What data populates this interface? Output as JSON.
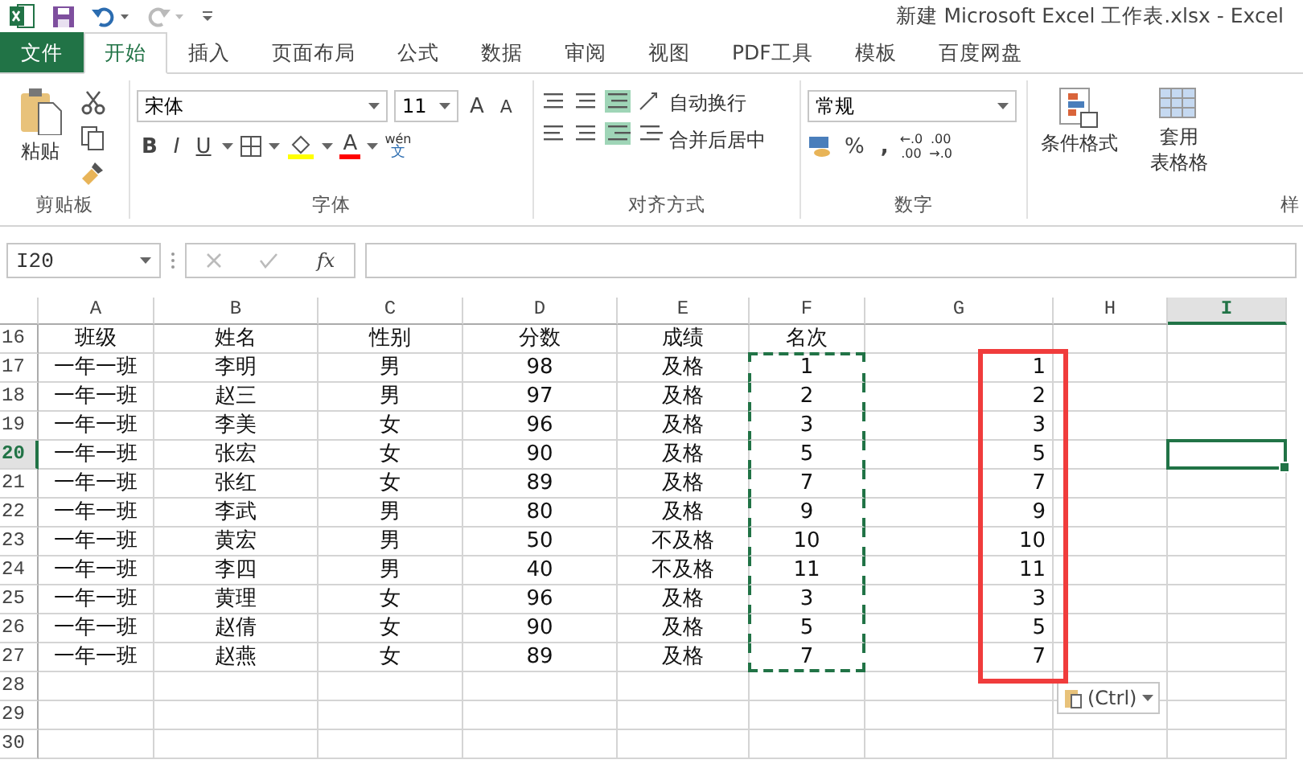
{
  "window": {
    "title": "新建 Microsoft Excel 工作表.xlsx - Excel"
  },
  "tabs": [
    {
      "label": "文件",
      "kind": "file",
      "selected": false
    },
    {
      "label": "开始",
      "kind": "tab",
      "selected": true
    },
    {
      "label": "插入",
      "kind": "tab",
      "selected": false
    },
    {
      "label": "页面布局",
      "kind": "tab",
      "selected": false
    },
    {
      "label": "公式",
      "kind": "tab",
      "selected": false
    },
    {
      "label": "数据",
      "kind": "tab",
      "selected": false
    },
    {
      "label": "审阅",
      "kind": "tab",
      "selected": false
    },
    {
      "label": "视图",
      "kind": "tab",
      "selected": false
    },
    {
      "label": "PDF工具",
      "kind": "tab",
      "selected": false
    },
    {
      "label": "模板",
      "kind": "tab",
      "selected": false
    },
    {
      "label": "百度网盘",
      "kind": "tab",
      "selected": false
    }
  ],
  "ribbon": {
    "clipboard": {
      "paste": "粘贴",
      "label": "剪贴板"
    },
    "font": {
      "name": "宋体",
      "size": "11",
      "grow": "A",
      "shrink": "A",
      "bold": "B",
      "italic": "I",
      "underline": "U",
      "font_color": "A",
      "phonetic_top": "wén",
      "phonetic_bottom": "文",
      "label": "字体"
    },
    "alignment": {
      "wrap": "自动换行",
      "merge": "合并后居中",
      "label": "对齐方式"
    },
    "number": {
      "format": "常规",
      "percent": "%",
      "comma": ",",
      "decimals": [
        {
          "top": "←.0",
          "bottom": ".00"
        },
        {
          "top": ".00",
          "bottom": "→.0"
        }
      ],
      "label": "数字"
    },
    "styles": {
      "conditional": "条件格式",
      "table_format_top": "套用",
      "table_format_bottom": "表格格",
      "label": "样"
    }
  },
  "formula_bar": {
    "name_box": "I20",
    "fx": "fx"
  },
  "columns": [
    {
      "label": "A",
      "selected": false
    },
    {
      "label": "B",
      "selected": false
    },
    {
      "label": "C",
      "selected": false
    },
    {
      "label": "D",
      "selected": false
    },
    {
      "label": "E",
      "selected": false
    },
    {
      "label": "F",
      "selected": false
    },
    {
      "label": "G",
      "selected": false
    },
    {
      "label": "H",
      "selected": false
    },
    {
      "label": "I",
      "selected": true
    }
  ],
  "rows": [
    {
      "number": "16",
      "selected": false,
      "copied": false,
      "marked": false,
      "cells": [
        "班级",
        "姓名",
        "性别",
        "分数",
        "成绩",
        "名次"
      ]
    },
    {
      "number": "17",
      "selected": false,
      "copied": true,
      "marked": true,
      "cells": [
        "一年一班",
        "李明",
        "男",
        "98",
        "及格",
        "1",
        "1"
      ]
    },
    {
      "number": "18",
      "selected": false,
      "copied": true,
      "marked": true,
      "cells": [
        "一年一班",
        "赵三",
        "男",
        "97",
        "及格",
        "2",
        "2"
      ]
    },
    {
      "number": "19",
      "selected": false,
      "copied": true,
      "marked": true,
      "cells": [
        "一年一班",
        "李美",
        "女",
        "96",
        "及格",
        "3",
        "3"
      ]
    },
    {
      "number": "20",
      "selected": true,
      "copied": true,
      "marked": true,
      "cells": [
        "一年一班",
        "张宏",
        "女",
        "90",
        "及格",
        "5",
        "5"
      ]
    },
    {
      "number": "21",
      "selected": false,
      "copied": true,
      "marked": true,
      "cells": [
        "一年一班",
        "张红",
        "女",
        "89",
        "及格",
        "7",
        "7"
      ]
    },
    {
      "number": "22",
      "selected": false,
      "copied": true,
      "marked": true,
      "cells": [
        "一年一班",
        "李武",
        "男",
        "80",
        "及格",
        "9",
        "9"
      ]
    },
    {
      "number": "23",
      "selected": false,
      "copied": true,
      "marked": true,
      "cells": [
        "一年一班",
        "黄宏",
        "男",
        "50",
        "不及格",
        "10",
        "10"
      ]
    },
    {
      "number": "24",
      "selected": false,
      "copied": true,
      "marked": true,
      "cells": [
        "一年一班",
        "李四",
        "男",
        "40",
        "不及格",
        "11",
        "11"
      ]
    },
    {
      "number": "25",
      "selected": false,
      "copied": true,
      "marked": true,
      "cells": [
        "一年一班",
        "黄理",
        "女",
        "96",
        "及格",
        "3",
        "3"
      ]
    },
    {
      "number": "26",
      "selected": false,
      "copied": true,
      "marked": true,
      "cells": [
        "一年一班",
        "赵倩",
        "女",
        "90",
        "及格",
        "5",
        "5"
      ]
    },
    {
      "number": "27",
      "selected": false,
      "copied": true,
      "marked": true,
      "cells": [
        "一年一班",
        "赵燕",
        "女",
        "89",
        "及格",
        "7",
        "7"
      ]
    },
    {
      "number": "28",
      "selected": false,
      "copied": false,
      "marked": false,
      "cells": []
    },
    {
      "number": "29",
      "selected": false,
      "copied": false,
      "marked": false,
      "cells": []
    },
    {
      "number": "30",
      "selected": false,
      "copied": false,
      "marked": false,
      "cells": []
    }
  ],
  "paste_options": {
    "label": "(Ctrl)"
  }
}
